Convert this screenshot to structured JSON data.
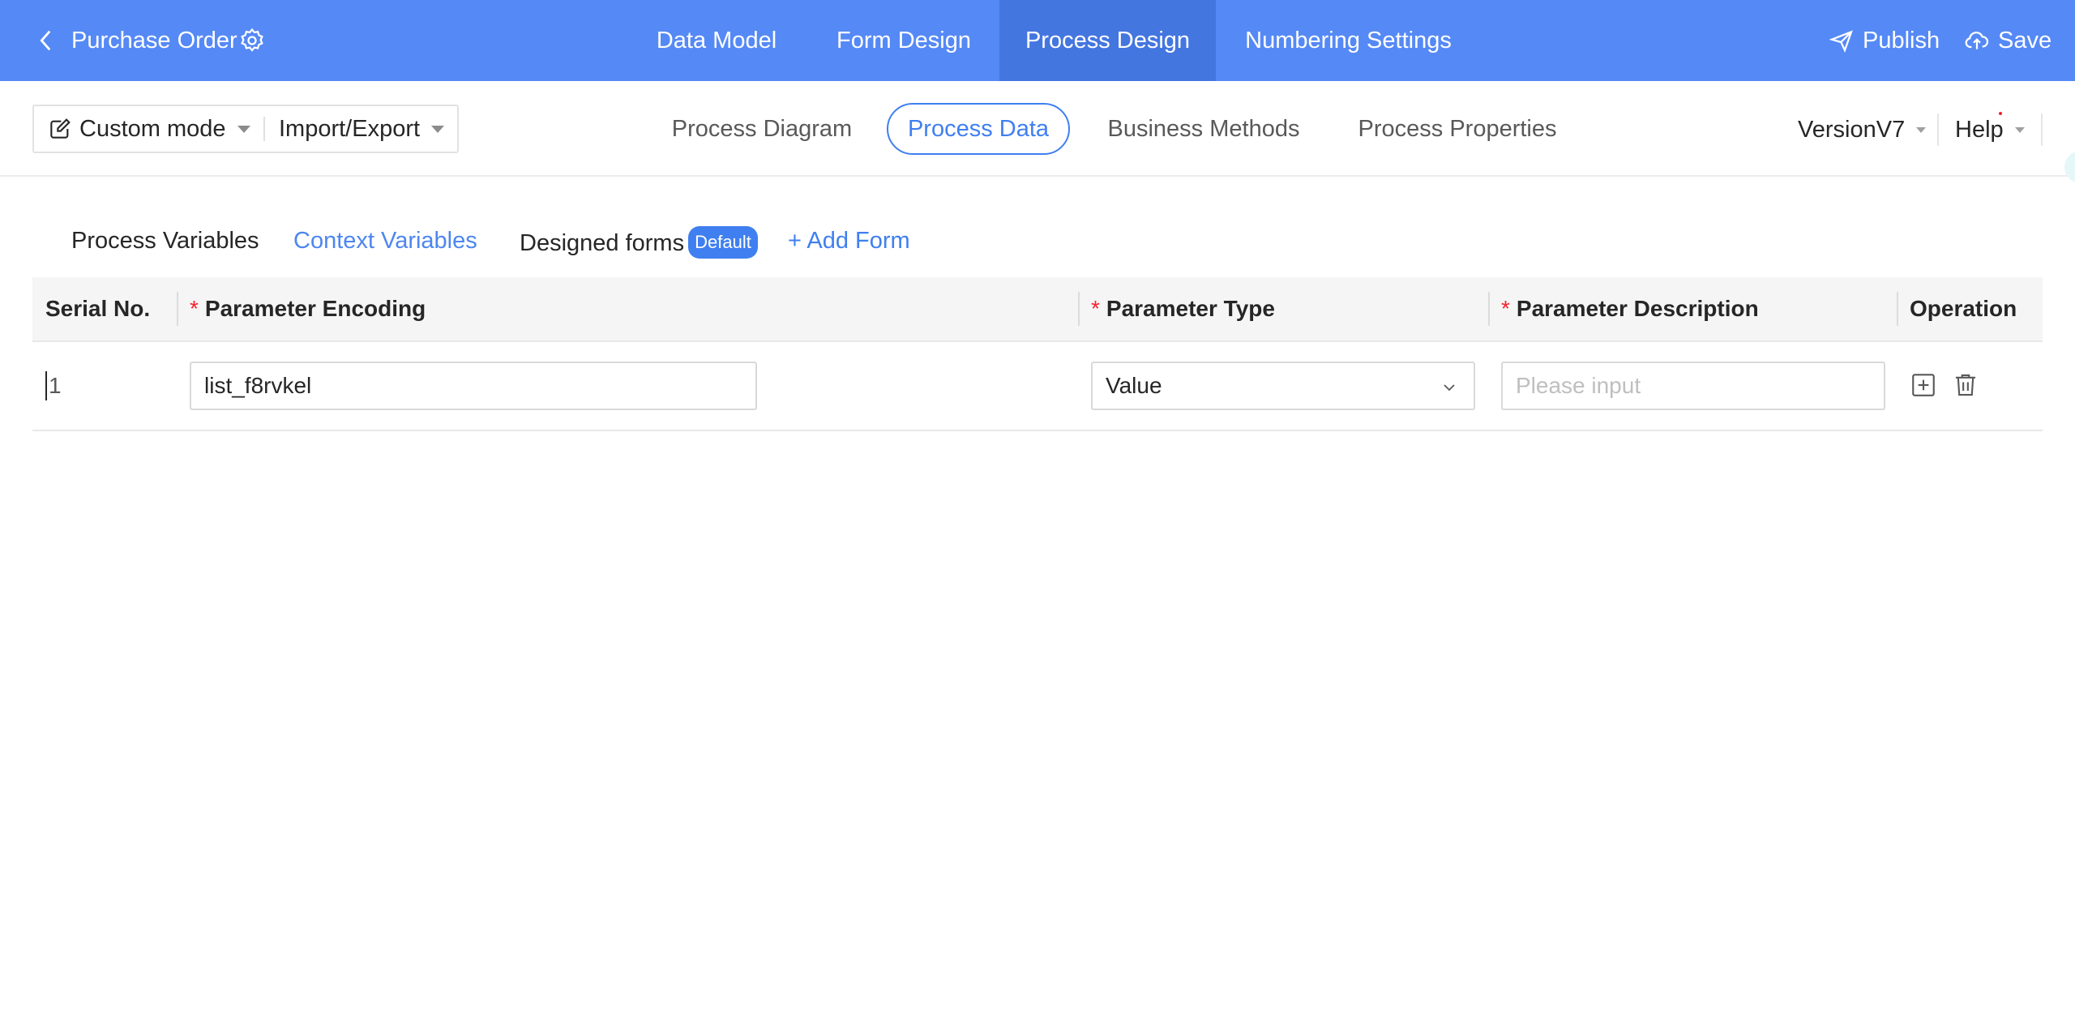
{
  "header": {
    "title": "Purchase Order",
    "nav": [
      "Data Model",
      "Form Design",
      "Process Design",
      "Numbering Settings"
    ],
    "active_nav": "Process Design",
    "publish_label": "Publish",
    "save_label": "Save"
  },
  "toolbar": {
    "mode_label": "Custom mode",
    "import_export_label": "Import/Export",
    "tabs": [
      "Process Diagram",
      "Process Data",
      "Business Methods",
      "Process Properties"
    ],
    "active_tab": "Process Data",
    "version_label": "VersionV7",
    "help_label": "Help"
  },
  "inner_tabs": {
    "process_variables": "Process Variables",
    "context_variables": "Context Variables",
    "designed_forms": "Designed forms",
    "default_badge": "Default",
    "add_form": "+ Add Form",
    "active": "Context Variables"
  },
  "table": {
    "columns": {
      "serial": "Serial No.",
      "encoding": "Parameter Encoding",
      "type": "Parameter Type",
      "description": "Parameter Description",
      "operation": "Operation"
    },
    "required_mark": "*",
    "rows": [
      {
        "serial": "1",
        "encoding": "list_f8rvkel",
        "type": "Value",
        "description": "",
        "description_placeholder": "Please input"
      }
    ]
  },
  "colors": {
    "header_bg": "#5589f5",
    "header_active_bg": "#4476e0",
    "accent": "#3f7ff0",
    "required": "#f5222d"
  },
  "icons": [
    "chevron-left-icon",
    "gear-icon",
    "send-icon",
    "cloud-upload-icon",
    "edit-note-icon",
    "chevron-down-icon",
    "plus-square-icon",
    "trash-icon"
  ]
}
